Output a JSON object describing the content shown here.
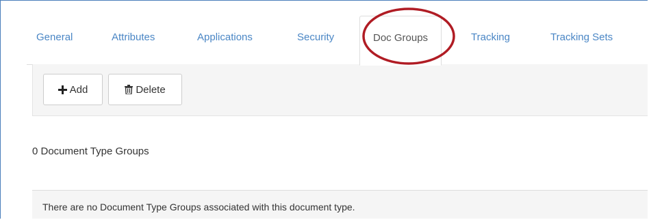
{
  "tabs": [
    {
      "label": "General"
    },
    {
      "label": "Attributes"
    },
    {
      "label": "Applications"
    },
    {
      "label": "Security"
    },
    {
      "label": "Doc Groups",
      "active": true
    },
    {
      "label": "Tracking"
    },
    {
      "label": "Tracking Sets"
    }
  ],
  "toolbar": {
    "add_label": "Add",
    "delete_label": "Delete"
  },
  "summary": {
    "count_text": "0 Document Type Groups"
  },
  "empty_state": {
    "message": "There are no Document Type Groups associated with this document type."
  },
  "colors": {
    "tab_link": "#4a86c5",
    "highlight_circle": "#b01c24",
    "frame_border": "#4a7ebb"
  },
  "icons": {
    "add": "plus-icon",
    "delete": "trash-icon"
  }
}
